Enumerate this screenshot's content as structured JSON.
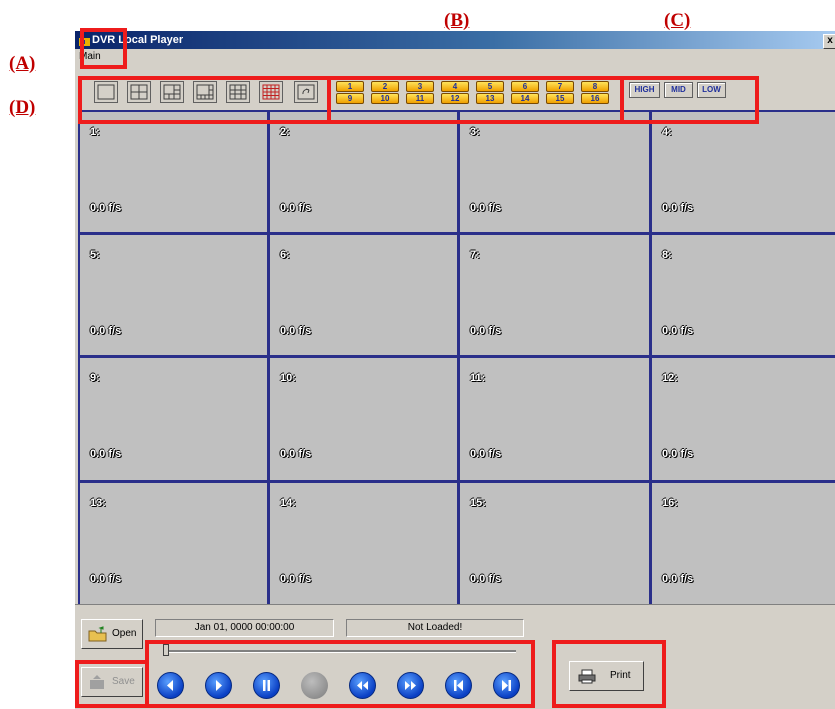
{
  "window": {
    "title": "DVR Local Player",
    "close_glyph": "x"
  },
  "menu": {
    "main": "Main"
  },
  "toolbar": {
    "layout_buttons": [
      "1x1",
      "2x2",
      "1+5",
      "1+7",
      "3x3",
      "4x4",
      "cycle"
    ],
    "channel_buttons": [
      "1",
      "2",
      "3",
      "4",
      "5",
      "6",
      "7",
      "8",
      "9",
      "10",
      "11",
      "12",
      "13",
      "14",
      "15",
      "16"
    ],
    "quality": {
      "high": "HIGH",
      "mid": "MID",
      "low": "LOW"
    }
  },
  "cells": [
    {
      "label": "1:",
      "fps": "0.0 f/s"
    },
    {
      "label": "2:",
      "fps": "0.0 f/s"
    },
    {
      "label": "3:",
      "fps": "0.0 f/s"
    },
    {
      "label": "4:",
      "fps": "0.0 f/s"
    },
    {
      "label": "5:",
      "fps": "0.0 f/s"
    },
    {
      "label": "6:",
      "fps": "0.0 f/s"
    },
    {
      "label": "7:",
      "fps": "0.0 f/s"
    },
    {
      "label": "8:",
      "fps": "0.0 f/s"
    },
    {
      "label": "9:",
      "fps": "0.0 f/s"
    },
    {
      "label": "10:",
      "fps": "0.0 f/s"
    },
    {
      "label": "11:",
      "fps": "0.0 f/s"
    },
    {
      "label": "12:",
      "fps": "0.0 f/s"
    },
    {
      "label": "13:",
      "fps": "0.0 f/s"
    },
    {
      "label": "14:",
      "fps": "0.0 f/s"
    },
    {
      "label": "15:",
      "fps": "0.0 f/s"
    },
    {
      "label": "16:",
      "fps": "0.0 f/s"
    }
  ],
  "controls": {
    "open": "Open",
    "save": "Save",
    "print": "Print",
    "datetime": "Jan 01, 0000  00:00:00",
    "status": "Not Loaded!",
    "slider_position": 0
  },
  "annotations": {
    "A": "(A)",
    "B": "(B)",
    "C": "(C)",
    "D": "(D)"
  },
  "colors": {
    "annotation": "#ee1c1c",
    "grid_line": "#2a2f8a",
    "cell_bg": "#c0c0c0"
  }
}
